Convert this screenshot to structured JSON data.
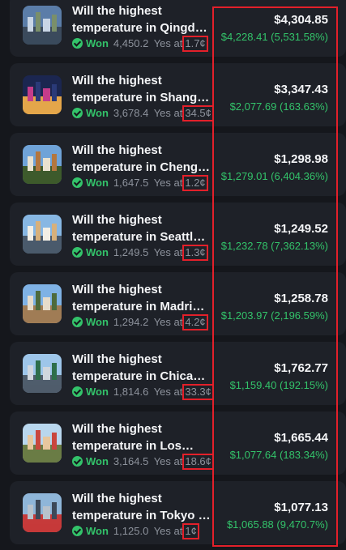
{
  "positions": [
    {
      "title_1": "Will the highest",
      "title_2": "temperature in Qingda…",
      "status": "Won",
      "shares": "4,450.2",
      "yes_at": "Yes at",
      "price": "1.7¢",
      "value": "$4,304.85",
      "pnl": "$4,228.41 (5,531.58%)",
      "thumb": "city-thumbnail"
    },
    {
      "title_1": "Will the highest",
      "title_2": "temperature in Shangha…",
      "status": "Won",
      "shares": "3,678.4",
      "yes_at": "Yes at",
      "price": "34.5¢",
      "value": "$3,347.43",
      "pnl": "$2,077.69 (163.63%)",
      "thumb": "city-thumbnail"
    },
    {
      "title_1": "Will the highest",
      "title_2": "temperature in Cheng…",
      "status": "Won",
      "shares": "1,647.5",
      "yes_at": "Yes at",
      "price": "1.2¢",
      "value": "$1,298.98",
      "pnl": "$1,279.01 (6,404.36%)",
      "thumb": "city-thumbnail"
    },
    {
      "title_1": "Will the highest",
      "title_2": "temperature in Seattle…",
      "status": "Won",
      "shares": "1,249.5",
      "yes_at": "Yes at",
      "price": "1.3¢",
      "value": "$1,249.52",
      "pnl": "$1,232.78 (7,362.13%)",
      "thumb": "city-thumbnail"
    },
    {
      "title_1": "Will the highest",
      "title_2": "temperature in Madrid…",
      "status": "Won",
      "shares": "1,294.2",
      "yes_at": "Yes at",
      "price": "4.2¢",
      "value": "$1,258.78",
      "pnl": "$1,203.97 (2,196.59%)",
      "thumb": "city-thumbnail"
    },
    {
      "title_1": "Will the highest",
      "title_2": "temperature in Chicago …",
      "status": "Won",
      "shares": "1,814.6",
      "yes_at": "Yes at",
      "price": "33.3¢",
      "value": "$1,762.77",
      "pnl": "$1,159.40 (192.15%)",
      "thumb": "city-thumbnail"
    },
    {
      "title_1": "Will the highest",
      "title_2": "temperature in Los…",
      "status": "Won",
      "shares": "3,164.5",
      "yes_at": "Yes at",
      "price": "18.6¢",
      "value": "$1,665.44",
      "pnl": "$1,077.64 (183.34%)",
      "thumb": "city-thumbnail"
    },
    {
      "title_1": "Will the highest",
      "title_2": "temperature in Tokyo b…",
      "status": "Won",
      "shares": "1,125.0",
      "yes_at": "Yes at",
      "price": "1¢",
      "value": "$1,077.13",
      "pnl": "$1,065.88 (9,470.7%)",
      "thumb": "city-thumbnail"
    }
  ],
  "colors": {
    "background": "#15171c",
    "row": "#1e2128",
    "positive": "#33c36a",
    "highlight": "#e3202a",
    "muted": "#8d929c"
  }
}
